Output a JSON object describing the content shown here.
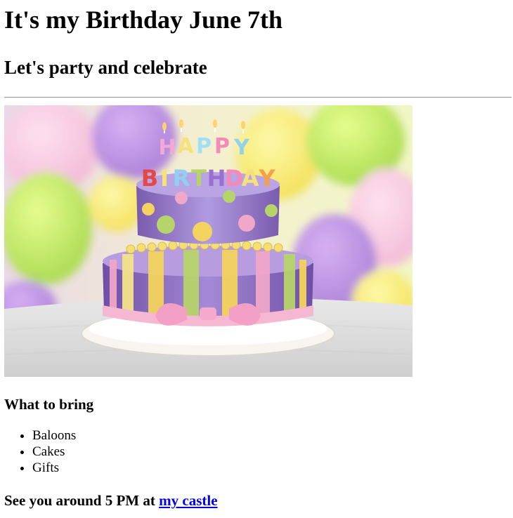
{
  "heading": "It's my Birthday June 7th",
  "subheading": "Let's party and celebrate",
  "image": {
    "candle_letters_top": [
      "H",
      "A",
      "P",
      "P",
      "Y"
    ],
    "candle_letters_bottom": [
      "B",
      "I",
      "R",
      "T",
      "H",
      "D",
      "A",
      "Y"
    ]
  },
  "bring": {
    "title": "What to bring",
    "items": [
      "Baloons",
      "Cakes",
      "Gifts"
    ]
  },
  "footer": {
    "text": "See you around 5 PM at ",
    "link_text": "my castle"
  },
  "colors": {
    "link": "#0000ee",
    "rule": "#9a9a9a"
  }
}
